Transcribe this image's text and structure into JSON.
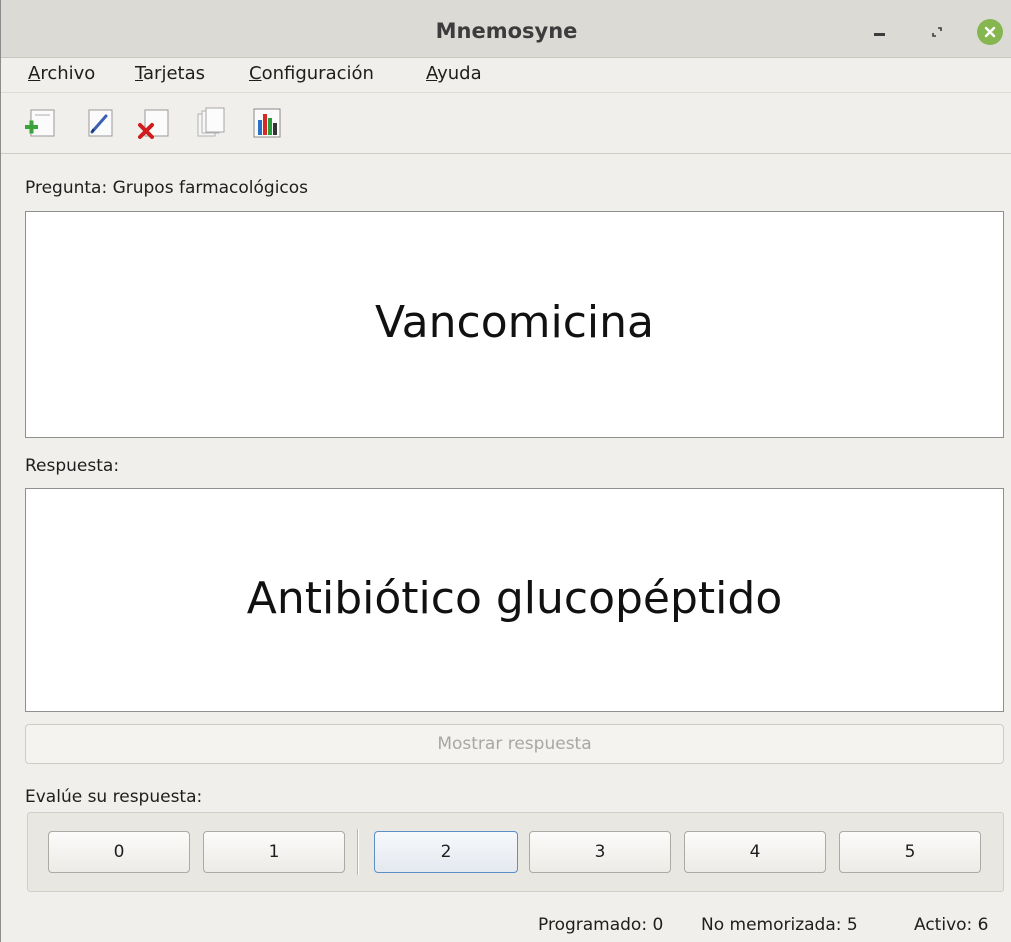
{
  "window": {
    "title": "Mnemosyne"
  },
  "menu": {
    "items": [
      {
        "accel": "A",
        "rest": "rchivo"
      },
      {
        "accel": "T",
        "rest": "arjetas"
      },
      {
        "accel": "C",
        "rest": "onfiguración"
      },
      {
        "accel": "A",
        "rest": "yuda"
      }
    ]
  },
  "toolbar": {
    "icons": [
      "add-card-icon",
      "edit-card-icon",
      "delete-card-icon",
      "card-browser-icon",
      "statistics-icon"
    ]
  },
  "question": {
    "label": "Pregunta: Grupos farmacológicos",
    "text": "Vancomicina"
  },
  "answer": {
    "label": "Respuesta:",
    "text": "Antibiótico glucopéptido"
  },
  "show_answer_label": "Mostrar respuesta",
  "grading": {
    "label": "Evalúe su respuesta:",
    "buttons": [
      "0",
      "1",
      "2",
      "3",
      "4",
      "5"
    ],
    "focused": "2"
  },
  "status": {
    "scheduled": "Programado: 0",
    "not_memorised": "No memorizada: 5",
    "active": "Activo: 6"
  },
  "colors": {
    "add_icon": "#3aa33a",
    "delete_icon": "#d01c1c",
    "close_button": "#86b650"
  }
}
